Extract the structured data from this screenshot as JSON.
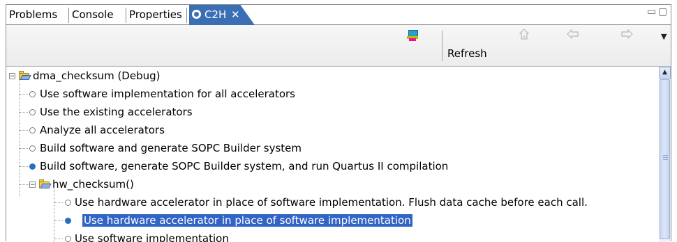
{
  "tabs": {
    "problems": "Problems",
    "console": "Console",
    "properties": "Properties",
    "c2h": "C2H",
    "close_glyph": "✕"
  },
  "window_controls": {
    "minimize_glyph": "▭",
    "maximize_glyph": "▢"
  },
  "toolbar": {
    "refresh_label": "Refresh",
    "icons": [
      "c2h-build-icon",
      "home-icon",
      "back-arrow-icon",
      "forward-arrow-icon",
      "view-menu-icon"
    ]
  },
  "tree": {
    "root": {
      "label": "dma_checksum (Debug)",
      "expanded": true
    },
    "root_options": [
      {
        "label": "Use software implementation for all accelerators",
        "selected": false
      },
      {
        "label": "Use the existing accelerators",
        "selected": false
      },
      {
        "label": "Analyze all accelerators",
        "selected": false
      },
      {
        "label": "Build software and generate SOPC Builder system",
        "selected": false
      },
      {
        "label": "Build software, generate SOPC Builder system, and run Quartus II compilation",
        "selected": true
      }
    ],
    "child": {
      "label": "hw_checksum()",
      "expanded": true
    },
    "child_options": [
      {
        "label": "Use hardware accelerator in place of software implementation. Flush data cache before each call.",
        "selected": false
      },
      {
        "label": "Use hardware accelerator in place of software implementation",
        "selected": true,
        "highlighted": true
      },
      {
        "label": "Use software implementation",
        "selected": false
      }
    ]
  },
  "colors": {
    "accent_tab": "#3b6fb5",
    "selection": "#3164c4",
    "radio_filled": "#2a6cc0"
  }
}
